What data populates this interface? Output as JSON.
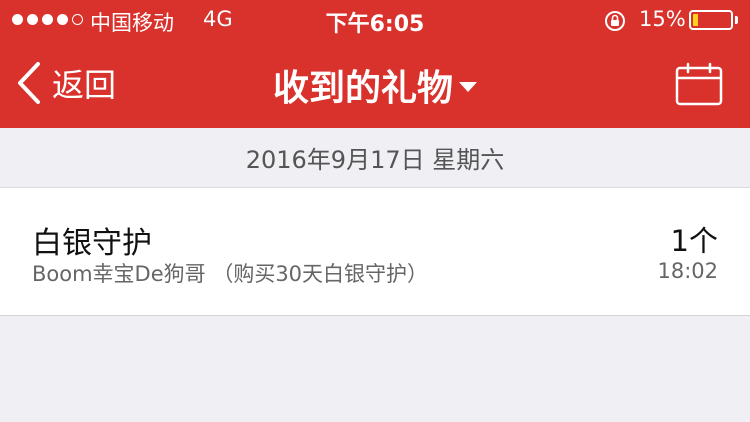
{
  "status_bar": {
    "carrier": "中国移动",
    "network": "4G",
    "time": "下午6:05",
    "battery_percent": "15%",
    "battery_level": 0.15,
    "signal_bars_filled": 4,
    "signal_bars_total": 5
  },
  "nav": {
    "back_label": "返回",
    "title": "收到的礼物",
    "back_icon": "chevron-left-icon",
    "dropdown_icon": "caret-down-icon",
    "calendar_icon": "calendar-icon"
  },
  "date_header": "2016年9月17日 星期六",
  "gifts": [
    {
      "name": "白银守护",
      "detail": "Boom幸宝De狗哥 （购买30天白银守护）",
      "count": "1个",
      "time": "18:02"
    }
  ],
  "colors": {
    "header_bg": "#d9312b",
    "page_bg": "#efeff4",
    "battery_fill": "#ffd21e"
  }
}
